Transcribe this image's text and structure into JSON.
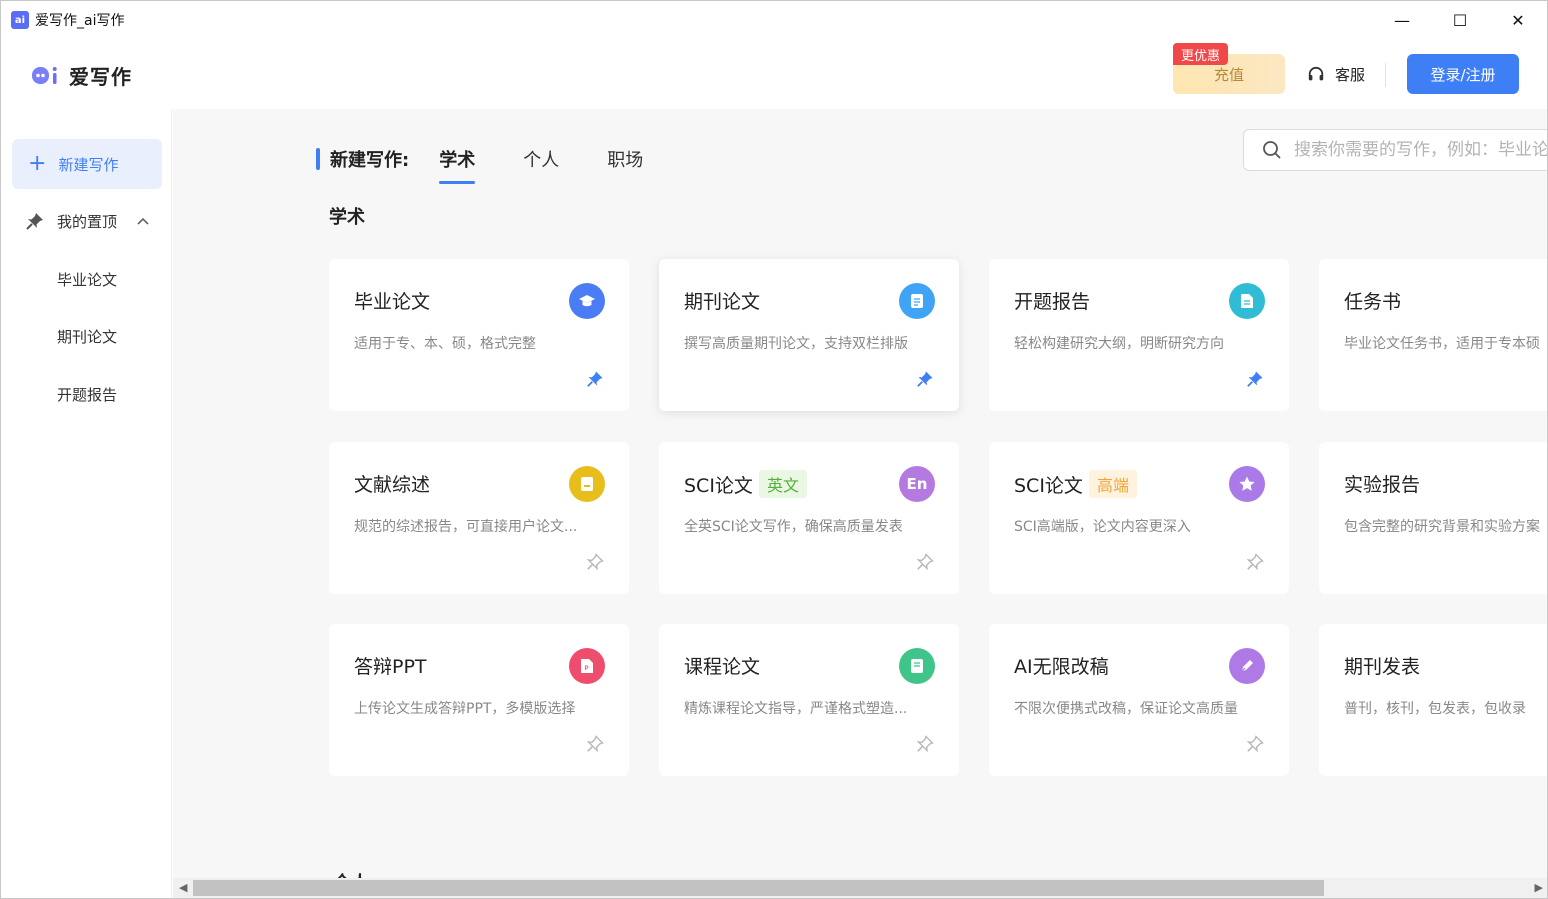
{
  "window": {
    "title": "爱写作_ai写作",
    "app_icon_text": "ai",
    "controls": {
      "minimize": "—",
      "maximize": "☐",
      "close": "✕"
    }
  },
  "header": {
    "brand": "爱写作",
    "recharge_label": "充值",
    "promo_badge": "更优惠",
    "service_label": "客服",
    "login_label": "登录/注册"
  },
  "sidebar": {
    "new_write_label": "新建写作",
    "pinned_label": "我的置顶",
    "pinned_items": [
      "毕业论文",
      "期刊论文",
      "开题报告"
    ]
  },
  "main": {
    "tabs_label": "新建写作:",
    "tabs": [
      "学术",
      "个人",
      "职场"
    ],
    "active_tab": "学术",
    "search_placeholder": "搜索你需要的写作，例如：毕业论文",
    "section_title": "学术",
    "next_section_partial": "个人",
    "cards": [
      {
        "title": "毕业论文",
        "desc": "适用于专、本、硕，格式完整",
        "icon": "graduation-cap-icon",
        "color": "#4a7df3",
        "pinned": true
      },
      {
        "title": "期刊论文",
        "desc": "撰写高质量期刊论文，支持双栏排版",
        "icon": "journal-document-icon",
        "color": "#3fa4f5",
        "pinned": true
      },
      {
        "title": "开题报告",
        "desc": "轻松构建研究大纲，明断研究方向",
        "icon": "report-document-icon",
        "color": "#2fbcd4",
        "pinned": true
      },
      {
        "title": "任务书",
        "desc": "毕业论文任务书，适用于专本硕",
        "icon": "task-book-icon",
        "color": "#3fa4f5",
        "pinned": false
      },
      {
        "title": "文献综述",
        "desc": "规范的综述报告，可直接用户论文...",
        "icon": "literature-icon",
        "color": "#e8be1c",
        "pinned": false
      },
      {
        "title": "SCI论文",
        "tag": "英文",
        "tag_style": "green",
        "desc": "全英SCI论文写作，确保高质量发表",
        "icon": "english-en-icon",
        "icon_text": "En",
        "color": "#b57ae0",
        "pinned": false
      },
      {
        "title": "SCI论文",
        "tag": "高端",
        "tag_style": "orange",
        "desc": "SCI高端版，论文内容更深入",
        "icon": "star-icon",
        "color": "#a97ae8",
        "pinned": false
      },
      {
        "title": "实验报告",
        "desc": "包含完整的研究背景和实验方案",
        "icon": "lab-report-icon",
        "color": "#3fa4f5",
        "pinned": false
      },
      {
        "title": "答辩PPT",
        "desc": "上传论文生成答辩PPT，多模版选择",
        "icon": "ppt-icon",
        "color": "#ef4d6e",
        "pinned": false
      },
      {
        "title": "课程论文",
        "desc": "精炼课程论文指导，严谨格式塑造...",
        "icon": "course-book-icon",
        "color": "#3fc48a",
        "pinned": false
      },
      {
        "title": "AI无限改稿",
        "desc": "不限次便携式改稿，保证论文高质量",
        "icon": "pen-edit-icon",
        "color": "#b07ae6",
        "pinned": false
      },
      {
        "title": "期刊发表",
        "desc": "普刊，核刊，包发表，包收录",
        "icon": "publish-icon",
        "color": "#3fa4f5",
        "pinned": false
      }
    ]
  },
  "colors": {
    "accent": "#3f7ff5",
    "pin_active": "#3f7ff5",
    "pin_inactive": "#b8b8b8"
  }
}
